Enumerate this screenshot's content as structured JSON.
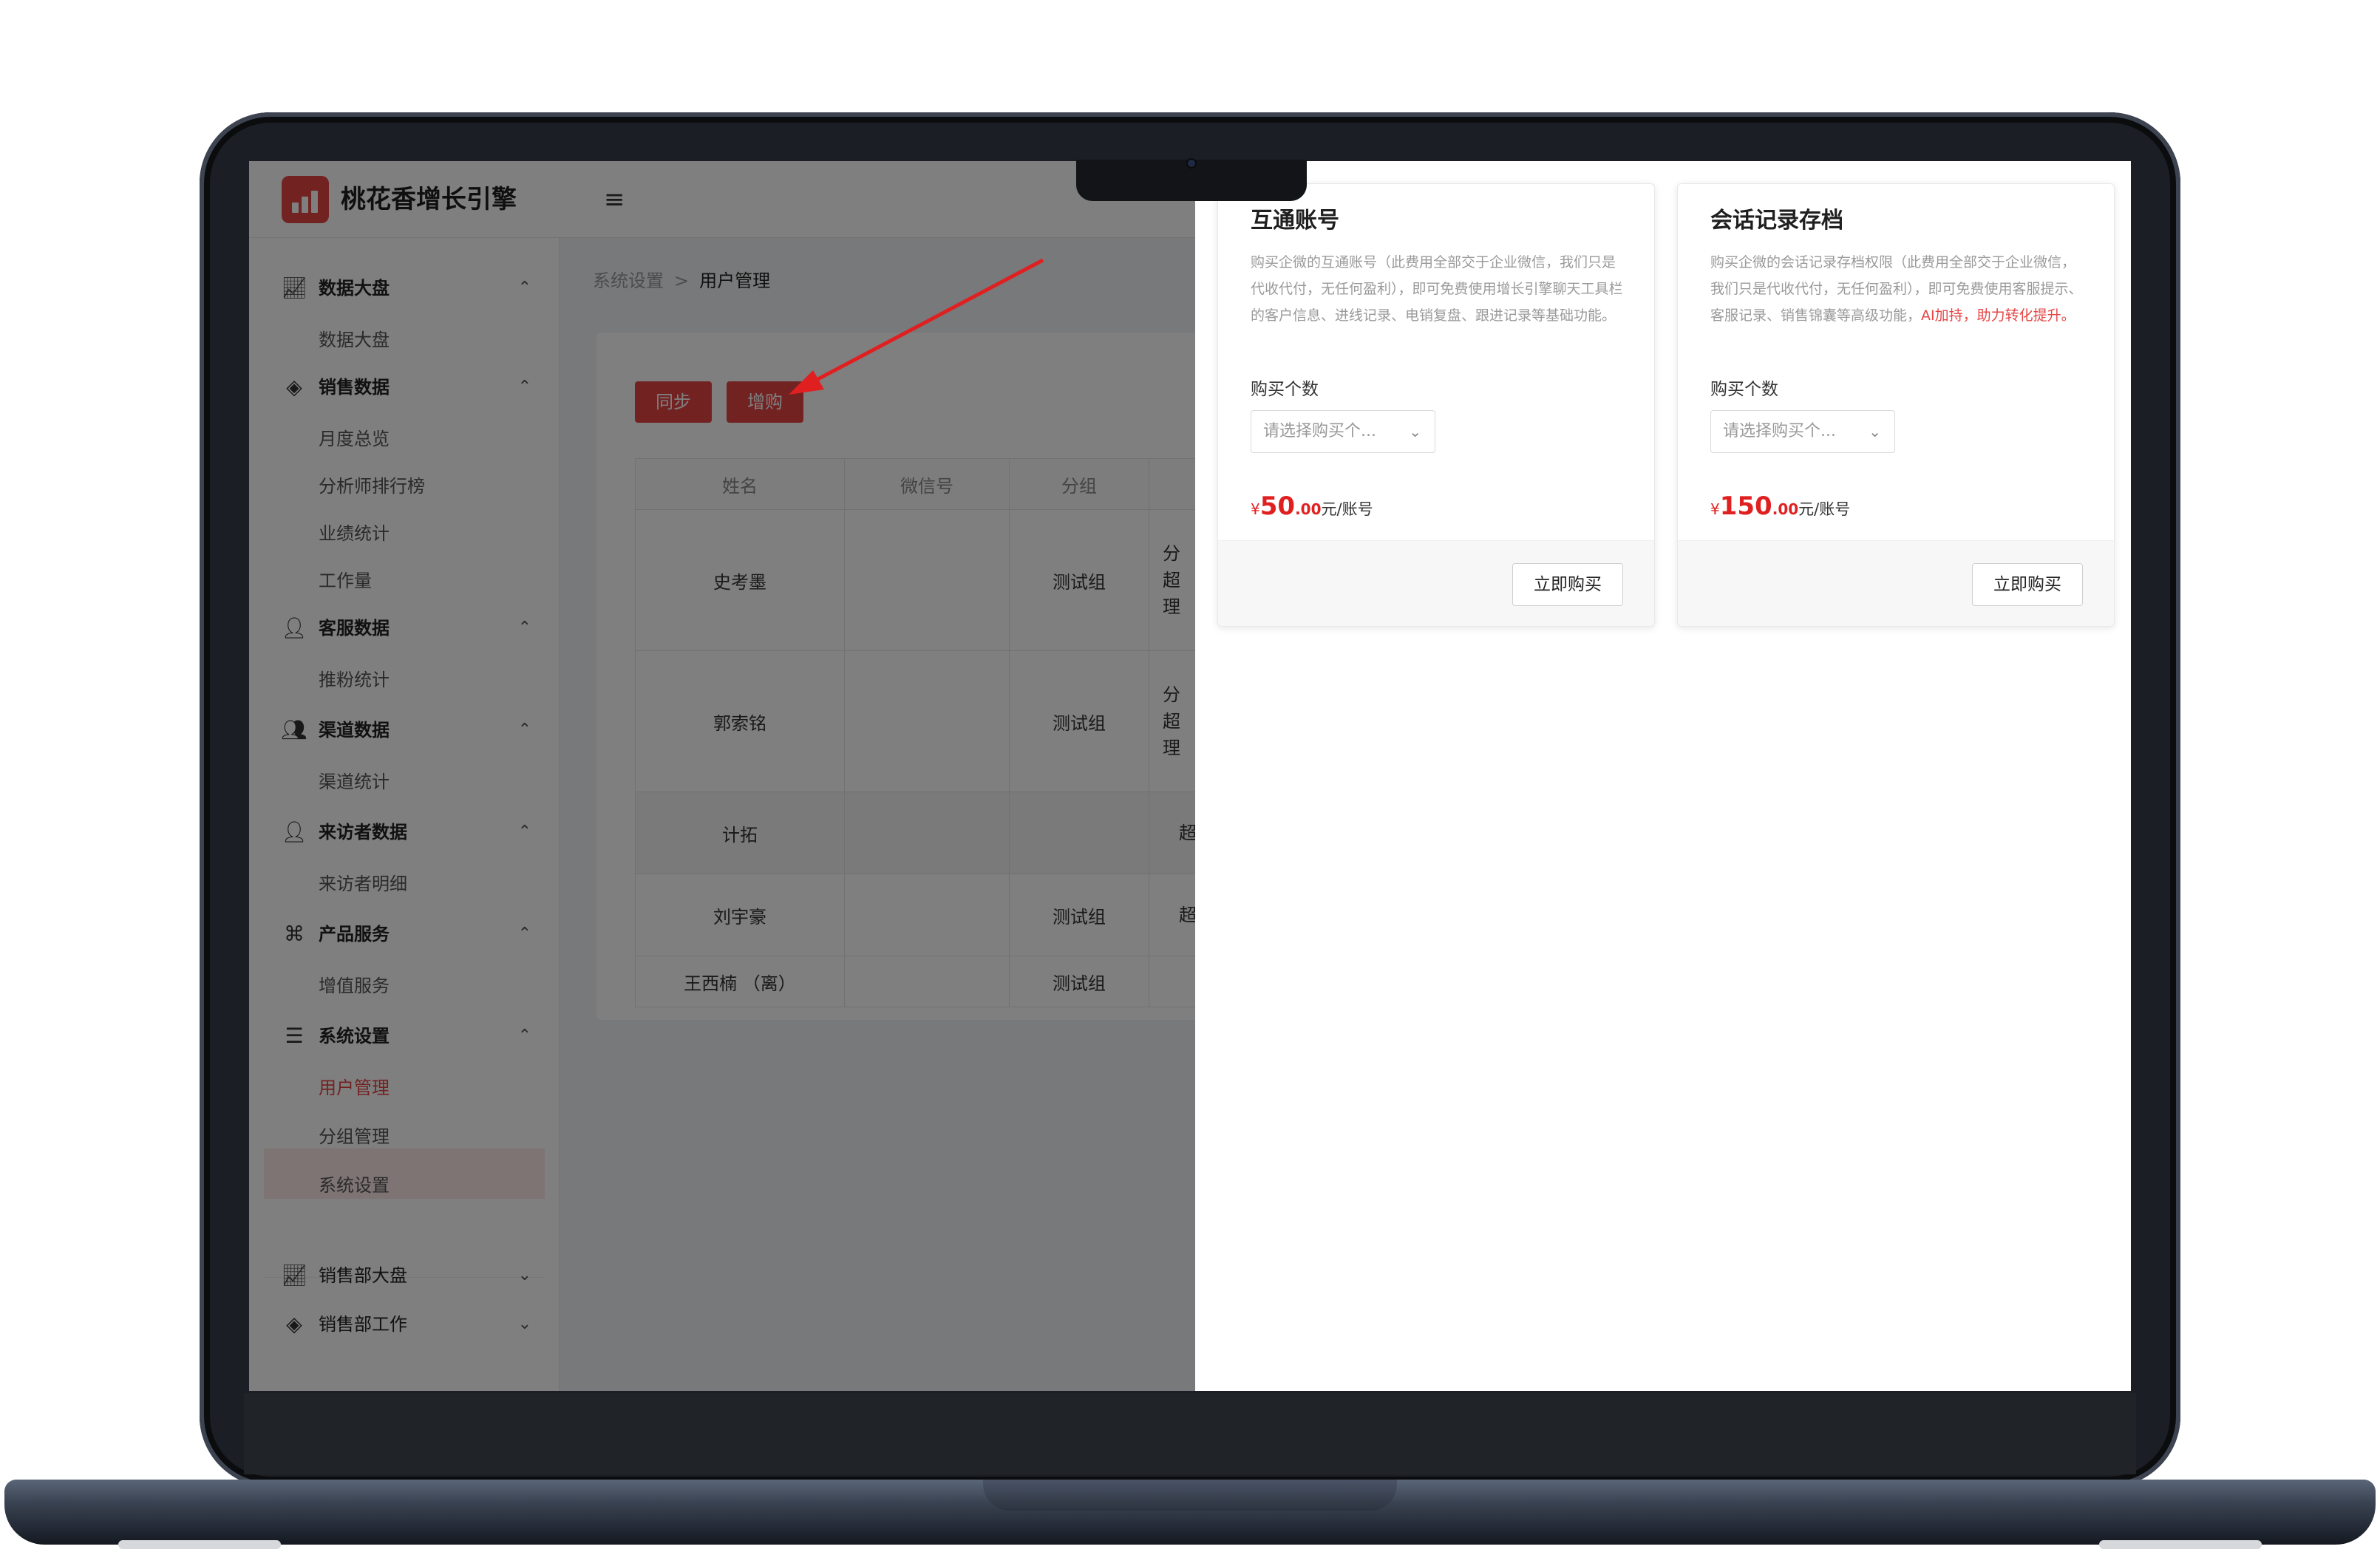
{
  "app": {
    "brand": "桃花香增长引擎",
    "menu_icon": "hamburger-icon"
  },
  "sidebar": {
    "groups": [
      {
        "label": "数据大盘",
        "icon": "chart-line-icon",
        "chevron": "⌃",
        "items": [
          "数据大盘"
        ]
      },
      {
        "label": "销售数据",
        "icon": "diamond-tag-icon",
        "chevron": "⌃",
        "items": [
          "月度总览",
          "分析师排行榜",
          "业绩统计",
          "工作量"
        ]
      },
      {
        "label": "客服数据",
        "icon": "user-headset-icon",
        "chevron": "⌃",
        "items": [
          "推粉统计"
        ]
      },
      {
        "label": "渠道数据",
        "icon": "users-group-icon",
        "chevron": "⌃",
        "items": [
          "渠道统计"
        ]
      },
      {
        "label": "来访者数据",
        "icon": "user-visit-icon",
        "chevron": "⌃",
        "items": [
          "来访者明细"
        ]
      },
      {
        "label": "产品服务",
        "icon": "command-icon",
        "chevron": "⌃",
        "items": [
          "增值服务"
        ]
      },
      {
        "label": "系统设置",
        "icon": "sliders-icon",
        "chevron": "⌃",
        "items": [
          "用户管理",
          "分组管理",
          "系统设置"
        ]
      },
      {
        "label": "销售部大盘",
        "icon": "chart-line-icon",
        "chevron": "⌄",
        "items": []
      },
      {
        "label": "销售部工作",
        "icon": "diamond-tag-icon",
        "chevron": "⌄",
        "items": []
      }
    ],
    "active_item": "用户管理"
  },
  "breadcrumb": {
    "parent": "系统设置",
    "separator": ">",
    "current": "用户管理"
  },
  "toolbar": {
    "sync_label": "同步",
    "purchase_label": "增购"
  },
  "table": {
    "headers": [
      "姓名",
      "微信号",
      "分组"
    ],
    "rows": [
      {
        "name": "史考墨",
        "wechat": "",
        "group": "测试组",
        "role": "分\n超\n理"
      },
      {
        "name": "郭索铭",
        "wechat": "",
        "group": "测试组",
        "role": "分\n超\n理"
      },
      {
        "name": "计拓",
        "wechat": "",
        "group": "",
        "role": "超"
      },
      {
        "name": "刘宇豪",
        "wechat": "",
        "group": "测试组",
        "role": "超"
      },
      {
        "name": "王西楠 （离）",
        "wechat": "",
        "group": "测试组",
        "role": ""
      }
    ]
  },
  "drawer": {
    "cards": [
      {
        "title": "互通账号",
        "desc": "购买企微的互通账号（此费用全部交于企业微信，我们只是代收代付，无任何盈利），即可免费使用增长引擎聊天工具栏的客户信息、进线记录、电销复盘、跟进记录等基础功能。",
        "highlight": "",
        "qty_label": "购买个数",
        "select_placeholder": "请选择购买个...",
        "price_currency": "¥",
        "price_int": "50",
        "price_dec": ".00",
        "price_unit": "元/账号",
        "buy_label": "立即购买"
      },
      {
        "title": "会话记录存档",
        "desc": "购买企微的会话记录存档权限（此费用全部交于企业微信，我们只是代收代付，无任何盈利），即可免费使用客服提示、客服记录、销售锦囊等高级功能，",
        "highlight": "AI加持，助力转化提升。",
        "qty_label": "购买个数",
        "select_placeholder": "请选择购买个...",
        "price_currency": "¥",
        "price_int": "150",
        "price_dec": ".00",
        "price_unit": "元/账号",
        "buy_label": "立即购买"
      }
    ]
  },
  "colors": {
    "accent": "#e64545",
    "price": "#e02020",
    "overlay": "rgba(0,0,0,0.5)"
  }
}
